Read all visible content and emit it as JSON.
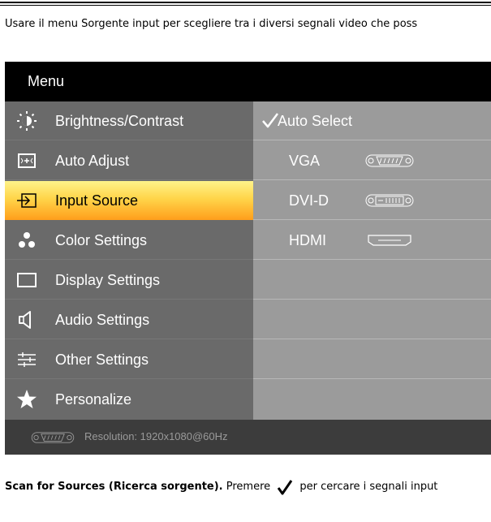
{
  "intro_text": "Usare il menu Sorgente input per scegliere tra i diversi segnali video che poss",
  "osd": {
    "title": "Menu",
    "menu_items": [
      {
        "label": "Brightness/Contrast",
        "icon": "brightness-icon"
      },
      {
        "label": "Auto Adjust",
        "icon": "auto-adjust-icon"
      },
      {
        "label": "Input Source",
        "icon": "input-source-icon",
        "active": true
      },
      {
        "label": "Color Settings",
        "icon": "color-settings-icon"
      },
      {
        "label": "Display Settings",
        "icon": "display-settings-icon"
      },
      {
        "label": "Audio Settings",
        "icon": "speaker-icon"
      },
      {
        "label": "Other Settings",
        "icon": "sliders-icon"
      },
      {
        "label": "Personalize",
        "icon": "star-icon"
      }
    ],
    "sources": [
      {
        "label": "Auto Select",
        "selected": true
      },
      {
        "label": "VGA",
        "connector": "vga-connector-icon"
      },
      {
        "label": "DVI-D",
        "connector": "dvi-connector-icon"
      },
      {
        "label": "HDMI",
        "connector": "hdmi-connector-icon"
      }
    ],
    "footer": {
      "resolution": "Resolution:  1920x1080@60Hz",
      "connector": "vga-connector-icon"
    },
    "colors": {
      "active_top": "#fff38a",
      "active_bottom": "#ff9e1b",
      "left_panel": "#6a6a6a",
      "right_panel": "#9b9b9b"
    }
  },
  "bottom": {
    "bold": "Scan for Sources (Ricerca sorgente).",
    "before": " Premere ",
    "after": " per cercare i segnali input"
  }
}
